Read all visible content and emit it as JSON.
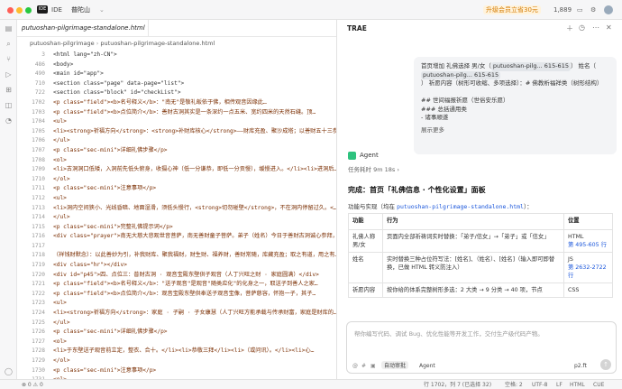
{
  "titlebar": {
    "ide_badge": "IDE",
    "ide_label": "IDE",
    "project": "普陀山",
    "upgrade": "升级会员立省30元",
    "count": "1,889"
  },
  "editor": {
    "tab": "putuoshan-pilgrimage-standalone.html",
    "breadcrumb": [
      "putuoshan-pilgrimage",
      "putuoshan-pilgrimage-standalone.html"
    ],
    "lines": [
      {
        "n": "3",
        "t": "<html lang=\"zh-CN\">",
        "sticky": true
      },
      {
        "n": "486",
        "t": "<body>",
        "sticky": true
      },
      {
        "n": "490",
        "t": "<main id=\"app\">",
        "sticky": true
      },
      {
        "n": "710",
        "t": "<section class=\"page\" data-page=\"list\">",
        "sticky": true
      },
      {
        "n": "722",
        "t": "<section class=\"block\" id=\"checkList\">",
        "sticky": true
      },
      {
        "n": "1702",
        "t": "<p class=\"field\"><b>名号释义</b>：\"南无\"是敬礼皈依于佛，相传观音因缘此…"
      },
      {
        "n": "1703",
        "t": "<p class=\"field\"><b>点位简介</b>：善财古洞其实是一条深约一点五米、宽约四米的天然石缝。顶…"
      },
      {
        "n": "1704",
        "t": "<ul>"
      },
      {
        "n": "1705",
        "t": "<li><strong>祈福方向</strong>：<strong>补财库核心</strong>——财库充盈、聚沙成塔；以善财五十三参…"
      },
      {
        "n": "1706",
        "t": "</ul>"
      },
      {
        "n": "1707",
        "t": "<p class=\"sec-mini\">详细礼佛步骤</p>"
      },
      {
        "n": "1708",
        "t": "<ol>"
      },
      {
        "n": "1709",
        "t": "<li>古洞洞口低矮，入洞前先低头俯身，收摄心神（低一分谦恭，即低一分贡慢），缓慢进入。</li><li>进洞后…"
      },
      {
        "n": "1710",
        "t": "</ol>"
      },
      {
        "n": "1711",
        "t": "<p class=\"sec-mini\">注意事项</p>"
      },
      {
        "n": "1712",
        "t": "<ul>"
      },
      {
        "n": "1713",
        "t": "<li>洞内空间狭小、光线昏暗、地面湿滑，须低头慢行，<strong>切勿碰壁</strong>，不在洞内停留过久。<…"
      },
      {
        "n": "1714",
        "t": "</ul>"
      },
      {
        "n": "1715",
        "t": "<p class=\"sec-mini\">完整礼佛提示词</p>"
      },
      {
        "n": "1716",
        "t": "<div class=\"prayer\">南无大慈大悲观世音菩萨，南无善财童子菩萨。弟子（姓名）今日于善财古洞诚心参拜，…"
      },
      {
        "n": "1717",
        "t": ""
      },
      {
        "n": "1718",
        "t": "（祥钱财默念）：以此善妙为引，补我财库、聚我福财，财生财、福养财，善财常随，库藏充盈；取之有道，用之有…"
      },
      {
        "n": "1719",
        "t": "<div class=\"hr\"></div>"
      },
      {
        "n": "1720",
        "t": "<div id=\"p45\">四、点位三：普财古洞 · 观音宝殿东壁供子观音（人丁兴旺之财 · 家庭圆满）</div>"
      },
      {
        "n": "1721",
        "t": "<p class=\"field\"><b>名号释义</b>：\"送子观音\"是观音\"随类应化\"的化身之一，取送子到善人之家…"
      },
      {
        "n": "1722",
        "t": "<p class=\"field\"><b>点位简介</b>：观音宝殿东壁供奉送子观音宝像，菩萨慈容，怀抱一子，其子…"
      },
      {
        "n": "1723",
        "t": "<ul>"
      },
      {
        "n": "1724",
        "t": "<li><strong>祈福方向</strong>：家庭 · 子嗣 · 子女康慧（人丁兴旺方能承载与传承财富，家庭是财库的…"
      },
      {
        "n": "1725",
        "t": "</ul>"
      },
      {
        "n": "1726",
        "t": "<p class=\"sec-mini\">详细礼佛步骤</p>"
      },
      {
        "n": "1727",
        "t": "<ol>"
      },
      {
        "n": "1728",
        "t": "<li>于东壁送子观音前立定，整衣、合十。</li><li>恭敬三拜</li><li>（或问讯）。</li><li>心…"
      },
      {
        "n": "1729",
        "t": "</ol>"
      },
      {
        "n": "1730",
        "t": "<p class=\"sec-mini\">注意事项</p>"
      },
      {
        "n": "1731",
        "t": "<ol>"
      },
      {
        "n": "1732",
        "t": "<li>求子者本身招戒善念。心诚即可。不可攀比、不可强求。</li><li>不可手持贵重物品触碰菩萨像…"
      }
    ]
  },
  "panel": {
    "title": "TRAE",
    "user_message": [
      "首页增加 礼佛选择 男/女（",
      "putuoshan-pilg... 615-615",
      "） 姓名（",
      "putuoshan-pilg... 615-615",
      "） 祈愿内容（树形可收缩、多项选择）：# 佛教析福祥类（树形结构）",
      "## 世间福报祈愿（世俗安乐愿）",
      "### 总括通用类",
      "- 诸事顺遂",
      "展示更多"
    ],
    "agent_label": "Agent",
    "task_time": "任务耗时 9m 18s",
    "done_title": "完成：首页「礼佛信息 · 个性化设置」面板",
    "subtitle_prefix": "功能与实现（均在 ",
    "subtitle_file": "putuoshan-pilgrimage-standalone.html",
    "subtitle_suffix": "）：",
    "table": {
      "headers": [
        "功能",
        "行为",
        "位置"
      ],
      "rows": [
        {
          "f": "礼佛人称 男/女",
          "b": "页面内全部祈祷词实时替换：「弟子/信女」→「弟子」或「信女」",
          "loc_type": "HTML",
          "loc": "第 495-605 行"
        },
        {
          "f": "姓名",
          "b": "实时替换三种占位符写法：[姓名]、（姓名）、[姓名]（输入即可即替换，已做 HTML 转义防注入）",
          "loc_type": "JS",
          "loc": "第 2632-2722 行"
        },
        {
          "f": "祈愿内容",
          "b": "按你给的体系完整树形多选：2 大类 → 9 分类 → 40 项，节点",
          "loc_type": "CSS",
          "loc": ""
        }
      ]
    },
    "input_placeholder": "帮你编写代码、调试 Bug、优化性能等开发工作，交付生产级代码产物。",
    "auto_approve": "自动审批",
    "agent_select": "Agent",
    "model": "p2.ft"
  },
  "statusbar": {
    "left": "⊗ 0 ⚠ 0",
    "pos": "行 1702，列 7 (已选择 32)",
    "spaces": "空格: 2",
    "encoding": "UTF-8",
    "eol": "LF",
    "lang": "HTML",
    "cue": "CUE"
  }
}
